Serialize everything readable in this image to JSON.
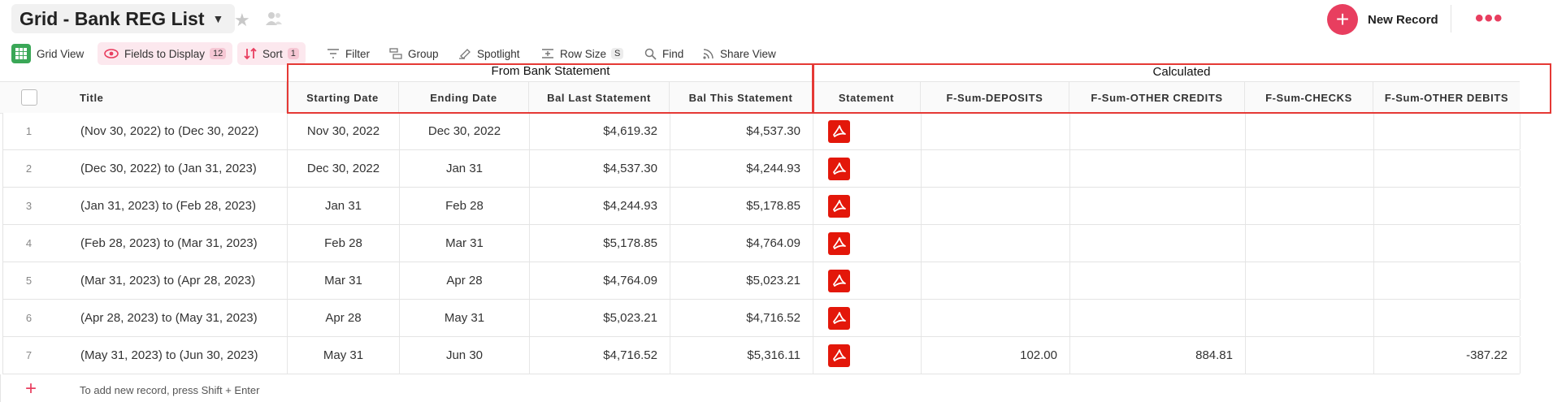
{
  "header": {
    "title": "Grid - Bank REG List",
    "new_record_label": "New Record"
  },
  "toolbar": {
    "grid_view": "Grid View",
    "fields": "Fields to Display",
    "fields_count": "12",
    "sort": "Sort",
    "sort_count": "1",
    "filter": "Filter",
    "group": "Group",
    "spotlight": "Spotlight",
    "row_size": "Row Size",
    "row_size_value": "S",
    "find": "Find",
    "share": "Share View"
  },
  "groups": {
    "bank": "From Bank Statement",
    "calculated": "Calculated"
  },
  "columns": {
    "title": "Title",
    "start": "Starting Date",
    "end": "Ending Date",
    "bal_last": "Bal Last Statement",
    "bal_this": "Bal This Statement",
    "statement": "Statement",
    "deposits": "F-Sum-DEPOSITS",
    "other_credits": "F-Sum-OTHER CREDITS",
    "checks": "F-Sum-CHECKS",
    "other_debits": "F-Sum-OTHER DEBITS"
  },
  "rows": [
    {
      "n": "1",
      "title": "(Nov 30, 2022) to (Dec 30, 2022)",
      "start": "Nov 30, 2022",
      "end": "Dec 30, 2022",
      "bal_last": "$4,619.32",
      "bal_this": "$4,537.30",
      "deposits": "",
      "other_credits": "",
      "checks": "",
      "other_debits": ""
    },
    {
      "n": "2",
      "title": "(Dec 30, 2022) to (Jan 31, 2023)",
      "start": "Dec 30, 2022",
      "end": "Jan 31",
      "bal_last": "$4,537.30",
      "bal_this": "$4,244.93",
      "deposits": "",
      "other_credits": "",
      "checks": "",
      "other_debits": ""
    },
    {
      "n": "3",
      "title": "(Jan 31, 2023) to (Feb 28, 2023)",
      "start": "Jan 31",
      "end": "Feb 28",
      "bal_last": "$4,244.93",
      "bal_this": "$5,178.85",
      "deposits": "",
      "other_credits": "",
      "checks": "",
      "other_debits": ""
    },
    {
      "n": "4",
      "title": "(Feb 28, 2023) to (Mar 31, 2023)",
      "start": "Feb 28",
      "end": "Mar 31",
      "bal_last": "$5,178.85",
      "bal_this": "$4,764.09",
      "deposits": "",
      "other_credits": "",
      "checks": "",
      "other_debits": ""
    },
    {
      "n": "5",
      "title": "(Mar 31, 2023) to (Apr 28, 2023)",
      "start": "Mar 31",
      "end": "Apr 28",
      "bal_last": "$4,764.09",
      "bal_this": "$5,023.21",
      "deposits": "",
      "other_credits": "",
      "checks": "",
      "other_debits": ""
    },
    {
      "n": "6",
      "title": "(Apr 28, 2023) to (May 31, 2023)",
      "start": "Apr 28",
      "end": "May 31",
      "bal_last": "$5,023.21",
      "bal_this": "$4,716.52",
      "deposits": "",
      "other_credits": "",
      "checks": "",
      "other_debits": ""
    },
    {
      "n": "7",
      "title": "(May 31, 2023) to (Jun 30, 2023)",
      "start": "May 31",
      "end": "Jun 30",
      "bal_last": "$4,716.52",
      "bal_this": "$5,316.11",
      "deposits": "102.00",
      "other_credits": "884.81",
      "checks": "",
      "other_debits": "-387.22"
    }
  ],
  "footer": {
    "add_hint": "To add new record, press Shift + Enter"
  },
  "colors": {
    "accent": "#e83e5f",
    "pdf": "#e3170a",
    "annotation": "#e53935",
    "grid_icon": "#3aa757"
  },
  "icons": {
    "grid": "grid-view-icon",
    "fields": "eye-icon",
    "sort": "sort-arrows-icon",
    "filter": "filter-icon",
    "group": "group-icon",
    "spotlight": "spotlight-icon",
    "row_size": "row-size-icon",
    "find": "search-icon",
    "share": "share-icon",
    "statement": "pdf-icon"
  }
}
